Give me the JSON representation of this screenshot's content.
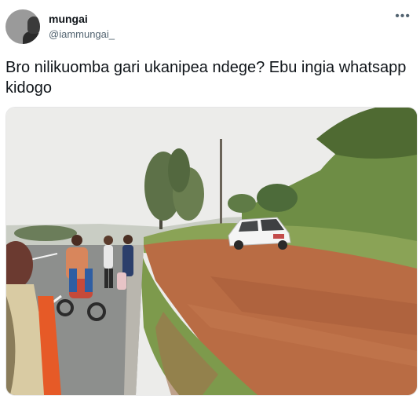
{
  "user": {
    "name": "mungai",
    "handle": "@iammungai_"
  },
  "menu": {
    "more_label": "•••"
  },
  "tweet": {
    "text": "Bro nilikuomba gari ukanipea ndege? Ebu ingia whatsapp kidogo"
  },
  "colors": {
    "text": "#0f1419",
    "secondary": "#536471",
    "sky": "#ececea",
    "road": "#8d8f8d",
    "dirt": "#b96c44",
    "grass": "#7d9a4c"
  }
}
